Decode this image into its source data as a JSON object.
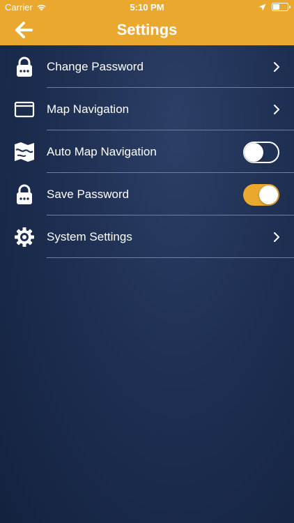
{
  "status_bar": {
    "carrier": "Carrier",
    "time": "5:10 PM",
    "icons": [
      "wifi-icon",
      "location-arrow-icon",
      "battery-icon"
    ]
  },
  "nav": {
    "title": "Settings",
    "back_icon": "back-arrow-icon"
  },
  "colors": {
    "accent": "#eaa92e",
    "background_top": "#2c3f66",
    "background_bottom": "#14223f",
    "divider": "#6f7fa0"
  },
  "settings": [
    {
      "label": "Change Password",
      "icon": "lock-icon",
      "control": "chevron"
    },
    {
      "label": "Map Navigation",
      "icon": "window-icon",
      "control": "chevron"
    },
    {
      "label": "Auto Map Navigation",
      "icon": "map-icon",
      "control": "toggle",
      "toggle_on": false
    },
    {
      "label": "Save Password",
      "icon": "lock-icon",
      "control": "toggle",
      "toggle_on": true
    },
    {
      "label": "System Settings",
      "icon": "gear-icon",
      "control": "chevron"
    }
  ]
}
